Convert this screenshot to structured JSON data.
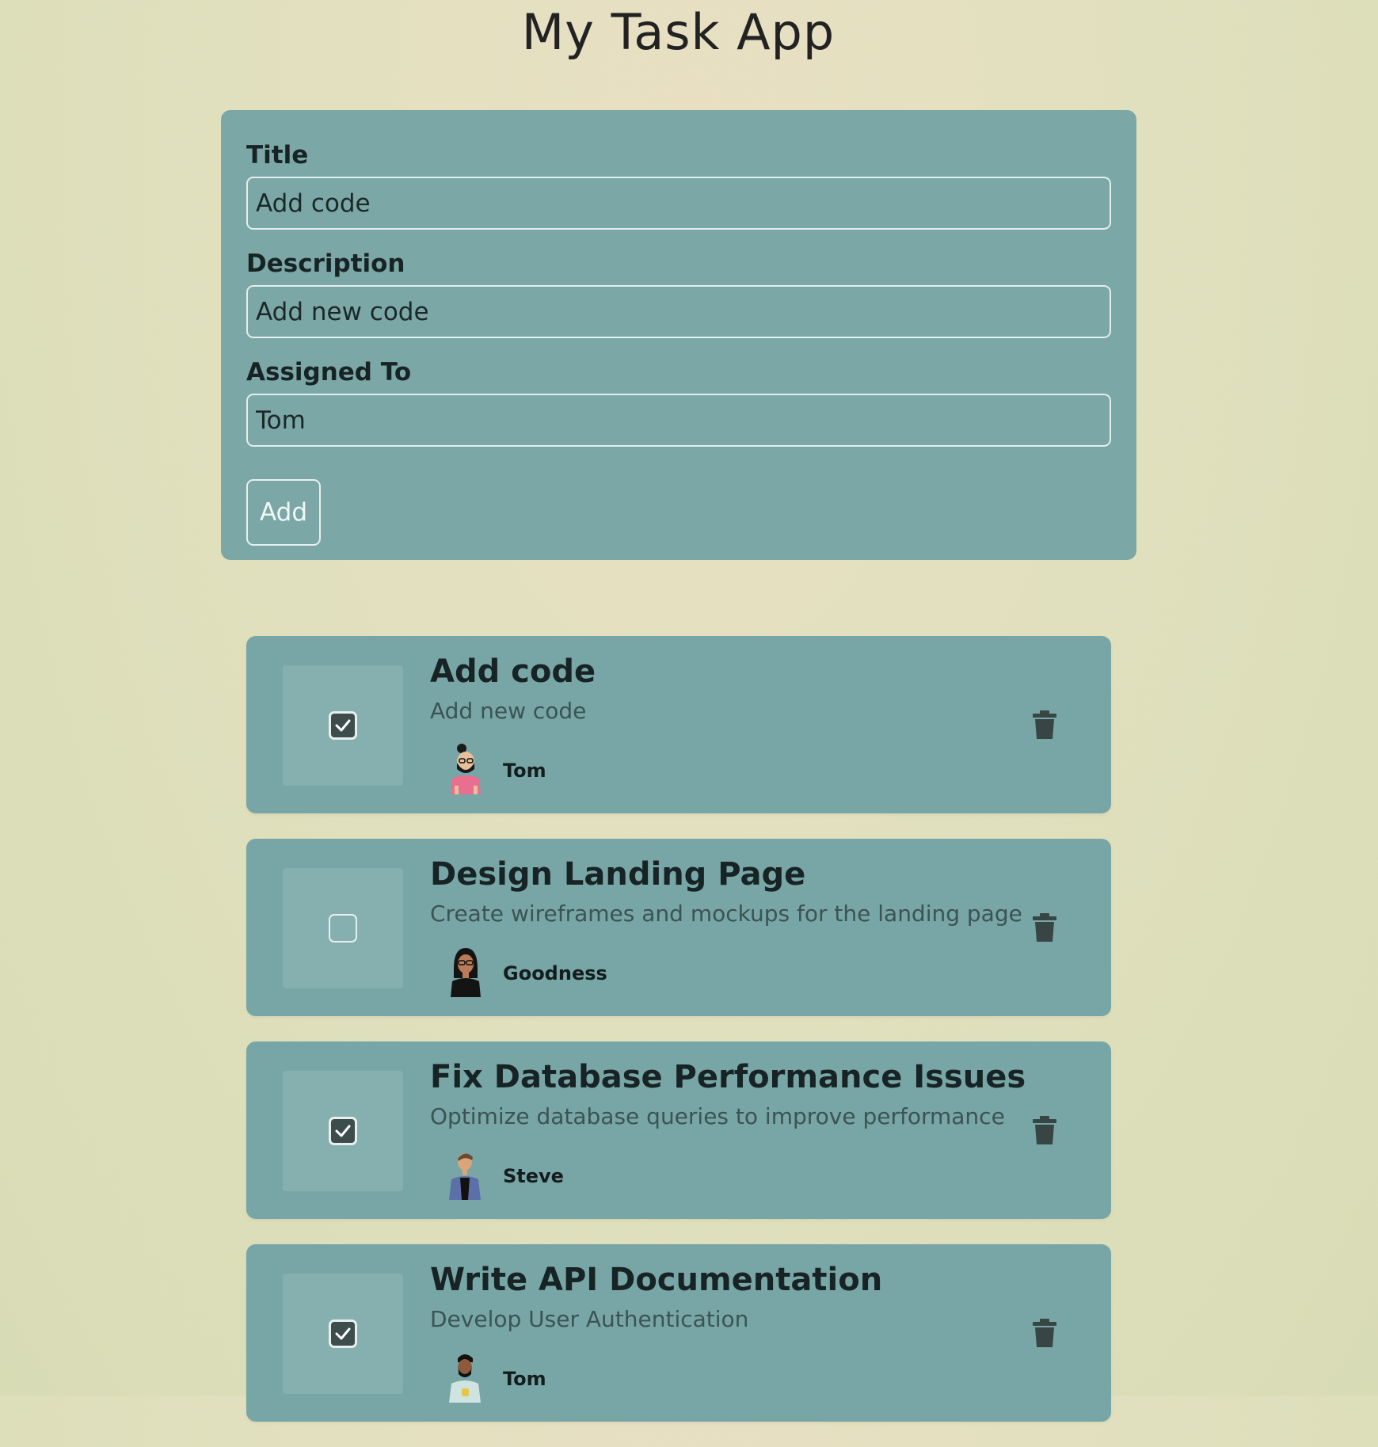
{
  "app": {
    "title": "My Task App"
  },
  "form": {
    "title_label": "Title",
    "title_value": "Add code",
    "description_label": "Description",
    "description_value": "Add new code",
    "assigned_label": "Assigned To",
    "assigned_value": "Tom",
    "add_label": "Add"
  },
  "tasks": [
    {
      "title": "Add code",
      "description": "Add new code",
      "assignee": "Tom",
      "completed": true
    },
    {
      "title": "Design Landing Page",
      "description": "Create wireframes and mockups for the landing page",
      "assignee": "Goodness",
      "completed": false
    },
    {
      "title": "Fix Database Performance Issues",
      "description": "Optimize database queries to improve performance",
      "assignee": "Steve",
      "completed": true
    },
    {
      "title": "Write API Documentation",
      "description": "Develop User Authentication",
      "assignee": "Tom",
      "completed": true
    }
  ],
  "icons": {
    "check": "check-icon",
    "delete": "trash-icon",
    "avatar": "person-avatar"
  },
  "colors": {
    "background": "#e3dfbe",
    "card": "#78a6a6",
    "checkbox_fill": "#3c4d4c",
    "trash": "#374645"
  }
}
